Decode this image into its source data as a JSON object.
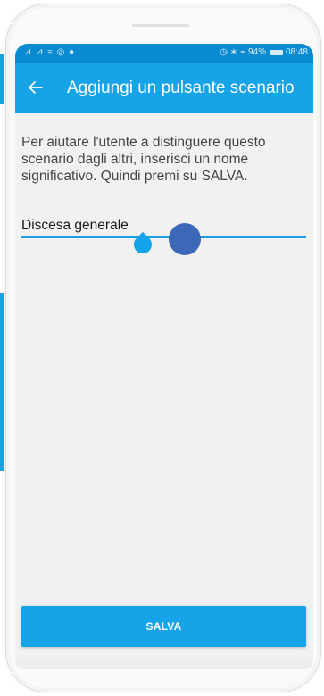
{
  "statusbar": {
    "left_icons": "⊿ ⊿ ≈ ◎ ●",
    "right_icons": "◷ ∗ ⌁",
    "battery_level": "94%",
    "time": "08:48"
  },
  "appbar": {
    "back_icon": "back-arrow-icon",
    "title": "Aggiungi un pulsante scenario"
  },
  "content": {
    "instructions": "Per aiutare l'utente a distinguere questo scenario dagli altri, inserisci un nome significativo. Quindi premi su SALVA.",
    "name_value": "Discesa generale"
  },
  "actions": {
    "save_label": "SALVA"
  },
  "colors": {
    "accent": "#17a3e8",
    "statusbar": "#0a8ad0",
    "touch_indicator": "#3d68b8"
  }
}
